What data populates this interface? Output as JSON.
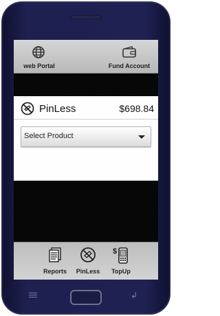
{
  "top_bar": {
    "items": [
      {
        "label": "web Portal",
        "icon": "globe-icon"
      },
      {
        "label": "Fund Account",
        "icon": "wallet-icon"
      }
    ]
  },
  "card": {
    "icon": "pinless-icon",
    "title": "PinLess",
    "amount": "$698.84",
    "select": {
      "value": "Select Product"
    }
  },
  "bottom_bar": {
    "items": [
      {
        "label": "Reports",
        "icon": "reports-icon"
      },
      {
        "label": "PinLess",
        "icon": "pinless-icon"
      },
      {
        "label": "TopUp",
        "icon": "topup-phone-icon"
      }
    ]
  },
  "colors": {
    "phone_body": "#1e2050",
    "bar_bg": "#c8c8c8",
    "screen_bg": "#050505"
  }
}
